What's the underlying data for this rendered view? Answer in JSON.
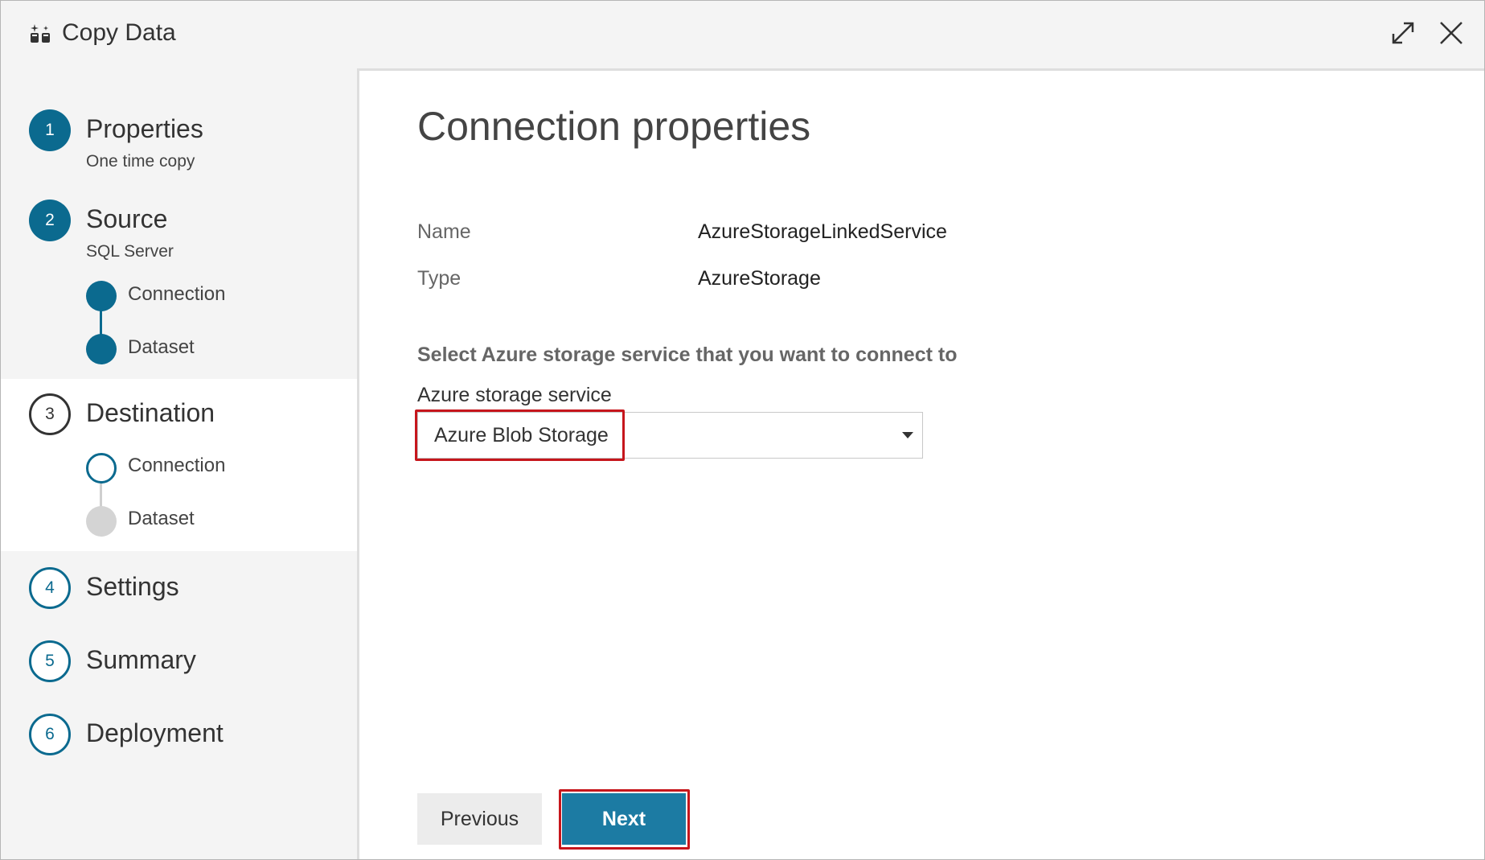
{
  "header": {
    "title": "Copy Data",
    "icon": "copy-data-icon",
    "expand_icon": "expand-icon",
    "close_icon": "close-icon"
  },
  "sidebar": {
    "steps": [
      {
        "number": "1",
        "title": "Properties",
        "subtitle": "One time copy",
        "state": "done"
      },
      {
        "number": "2",
        "title": "Source",
        "subtitle": "SQL Server",
        "state": "done",
        "substeps": [
          {
            "label": "Connection",
            "state": "done"
          },
          {
            "label": "Dataset",
            "state": "done"
          }
        ]
      },
      {
        "number": "3",
        "title": "Destination",
        "state": "current",
        "substeps": [
          {
            "label": "Connection",
            "state": "current"
          },
          {
            "label": "Dataset",
            "state": "pending"
          }
        ]
      },
      {
        "number": "4",
        "title": "Settings",
        "state": "pending"
      },
      {
        "number": "5",
        "title": "Summary",
        "state": "pending"
      },
      {
        "number": "6",
        "title": "Deployment",
        "state": "pending"
      }
    ]
  },
  "main": {
    "title": "Connection properties",
    "properties": [
      {
        "label": "Name",
        "value": "AzureStorageLinkedService"
      },
      {
        "label": "Type",
        "value": "AzureStorage"
      }
    ],
    "section_heading": "Select Azure storage service that you want to connect to",
    "field_label": "Azure storage service",
    "select_value": "Azure Blob Storage",
    "previous_label": "Previous",
    "next_label": "Next"
  },
  "colors": {
    "accent": "#0b6a8f",
    "primary_button": "#1c7ba3",
    "highlight_outline": "#c6161c"
  }
}
